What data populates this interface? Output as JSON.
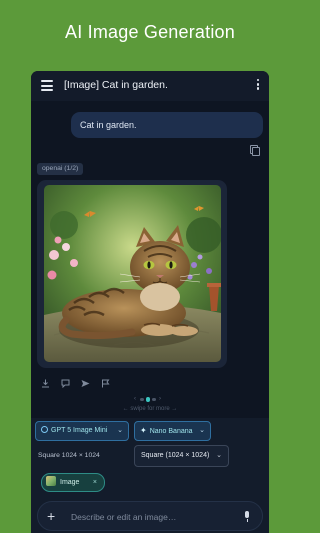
{
  "banner": {
    "title": "AI Image Generation"
  },
  "app_bar": {
    "title": "[Image] Cat in garden."
  },
  "messages": {
    "user_text": "Cat in garden.",
    "provider_label": "openai (1/2)"
  },
  "pager": {
    "swipe_hint": "← swipe for more →",
    "page_index": 2,
    "page_count": 3
  },
  "models": [
    {
      "label": "GPT 5 Image Mini",
      "icon": "openai-icon"
    },
    {
      "label": "Nano Banana",
      "icon": "sparkle-icon"
    }
  ],
  "size": {
    "label": "Square 1024 × 1024",
    "selected": "Square (1024 × 1024)"
  },
  "attachment": {
    "label": "Image",
    "remove_glyph": "×"
  },
  "composer": {
    "placeholder": "Describe or edit an image…",
    "add_glyph": "+"
  },
  "colors": {
    "page_background": "#5c9a3a",
    "app_background": "#0e1522",
    "user_bubble": "#1e2f4d",
    "accent_teal": "#3bc6c1"
  }
}
